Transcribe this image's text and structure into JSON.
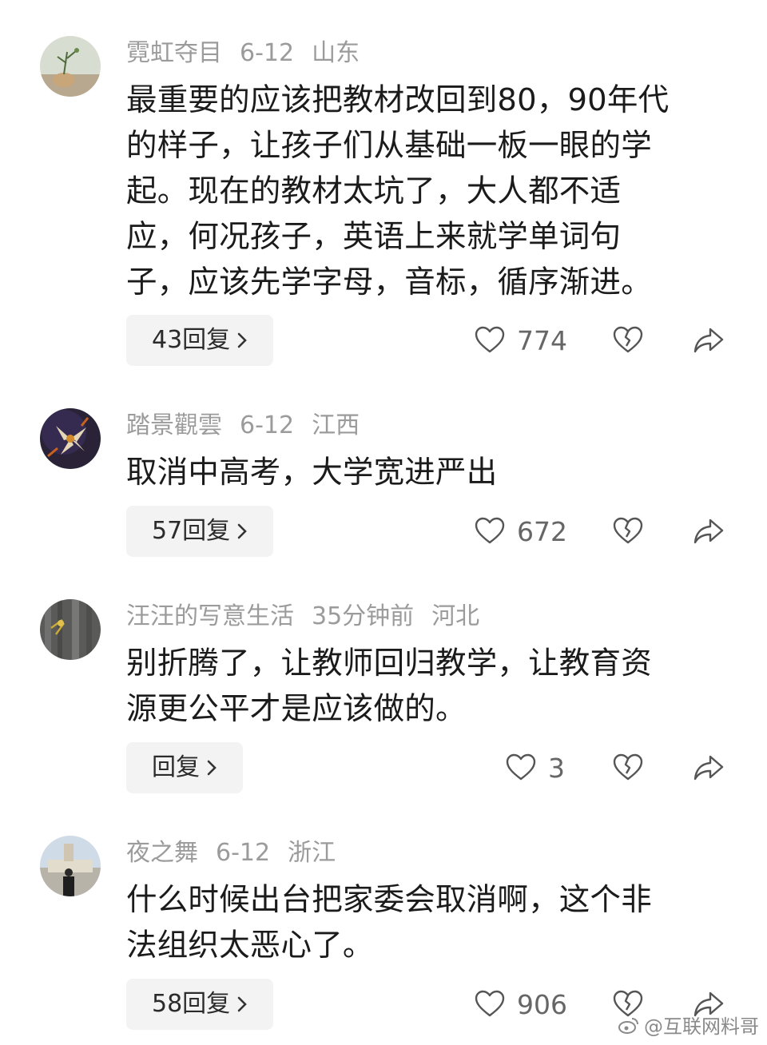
{
  "comments": [
    {
      "username": "霓虹夺目",
      "date": "6-12",
      "location": "山东",
      "lines": [
        "最重要的应该把教材改回到80，90年代",
        "的样子，让孩子们从基础一板一眼的学",
        "起。现在的教材太坑了，大人都不适",
        "应，何况孩子，英语上来就学单词句",
        "子，应该先学字母，音标，循序渐进。"
      ],
      "reply_label": "43回复",
      "like_count": "774",
      "avatar": "avatar-plant-icon"
    },
    {
      "username": "踏景觀雲",
      "date": "6-12",
      "location": "江西",
      "lines": [
        "取消中高考，大学宽进严出"
      ],
      "reply_label": "57回复",
      "like_count": "672",
      "avatar": "avatar-flower-icon"
    },
    {
      "username": "汪汪的写意生活",
      "date": "35分钟前",
      "location": "河北",
      "lines": [
        "别折腾了，让教师回归教学，让教育资",
        "源更公平才是应该做的。"
      ],
      "reply_label": "回复",
      "like_count": "3",
      "avatar": "avatar-wood-icon"
    },
    {
      "username": "夜之舞",
      "date": "6-12",
      "location": "浙江",
      "lines": [
        "什么时候出台把家委会取消啊，这个非",
        "法组织太恶心了。"
      ],
      "reply_label": "58回复",
      "like_count": "906",
      "avatar": "avatar-person-icon"
    }
  ],
  "watermark": "@互联网料哥",
  "colors": {
    "meta": "#9b9b9b",
    "text": "#1b1b1b",
    "reply_bg": "#f3f3f3"
  }
}
